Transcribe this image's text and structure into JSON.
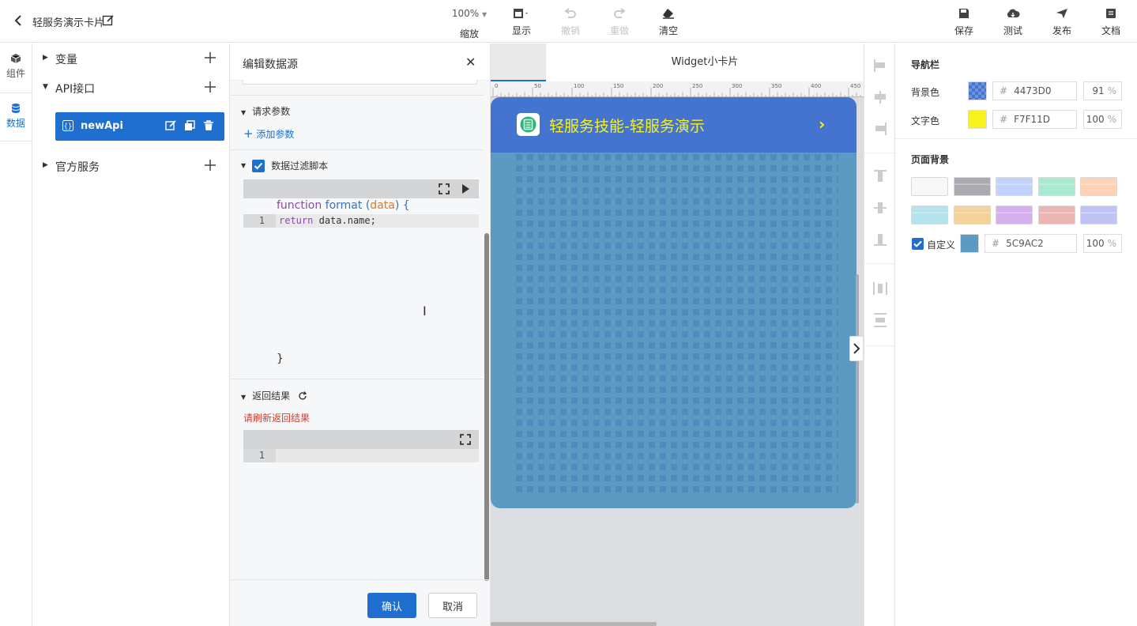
{
  "header": {
    "title": "轻服务演示卡片",
    "zoom": {
      "value": "100%",
      "label": "缩放"
    },
    "tools": [
      {
        "label": "显示"
      },
      {
        "label": "撤销"
      },
      {
        "label": "重做"
      },
      {
        "label": "清空"
      }
    ],
    "actions": [
      {
        "label": "保存"
      },
      {
        "label": "测试"
      },
      {
        "label": "发布"
      },
      {
        "label": "文档"
      }
    ]
  },
  "rail": {
    "items": [
      {
        "label": "组件"
      },
      {
        "label": "数据"
      }
    ]
  },
  "tree": {
    "variables": "变量",
    "api": "API接口",
    "api_item": "newApi",
    "official": "官方服务"
  },
  "editor": {
    "title": "编辑数据源",
    "request_params": "请求参数",
    "add_param": "添加参数",
    "filter_script": "数据过滤脚本",
    "code": {
      "kw_function": "function",
      "fn_name": "format",
      "paren_open": "(",
      "param": "data",
      "paren_close": ") {",
      "line_no": "1",
      "kw_return": "return",
      "body": "data.name;",
      "closing": "}"
    },
    "result_title": "返回结果",
    "result_hint": "请刷新返回结果",
    "result_line_no": "1",
    "confirm": "确认",
    "cancel": "取消"
  },
  "canvas": {
    "tab": "Widget小卡片",
    "ruler_ticks": [
      "0",
      "50",
      "100",
      "150",
      "200",
      "250",
      "300",
      "350",
      "400",
      "450"
    ],
    "card": {
      "title": "轻服务技能-轻服务演示",
      "arrow": "›",
      "nav_color": "#4473D0",
      "text_color": "#F7F11D",
      "bg_color": "#5C9AC2"
    }
  },
  "props": {
    "nav_title": "导航栏",
    "bg_label": "背景色",
    "bg_hex": "4473D0",
    "bg_pct": "91",
    "text_label": "文字色",
    "text_hex": "F7F11D",
    "text_pct": "100",
    "page_bg_title": "页面背景",
    "swatches": [
      "#f6f7f9",
      "#a9abb0",
      "#c1d3fa",
      "#a8e9d0",
      "#fdd2b6",
      "#b5e3ec",
      "#f4d39b",
      "#d6b0ee",
      "#eab5b2",
      "#c0c3f4"
    ],
    "custom_label": "自定义",
    "custom_hex": "5C9AC2",
    "custom_pct": "100",
    "hash": "#",
    "pct_sign": "%"
  }
}
